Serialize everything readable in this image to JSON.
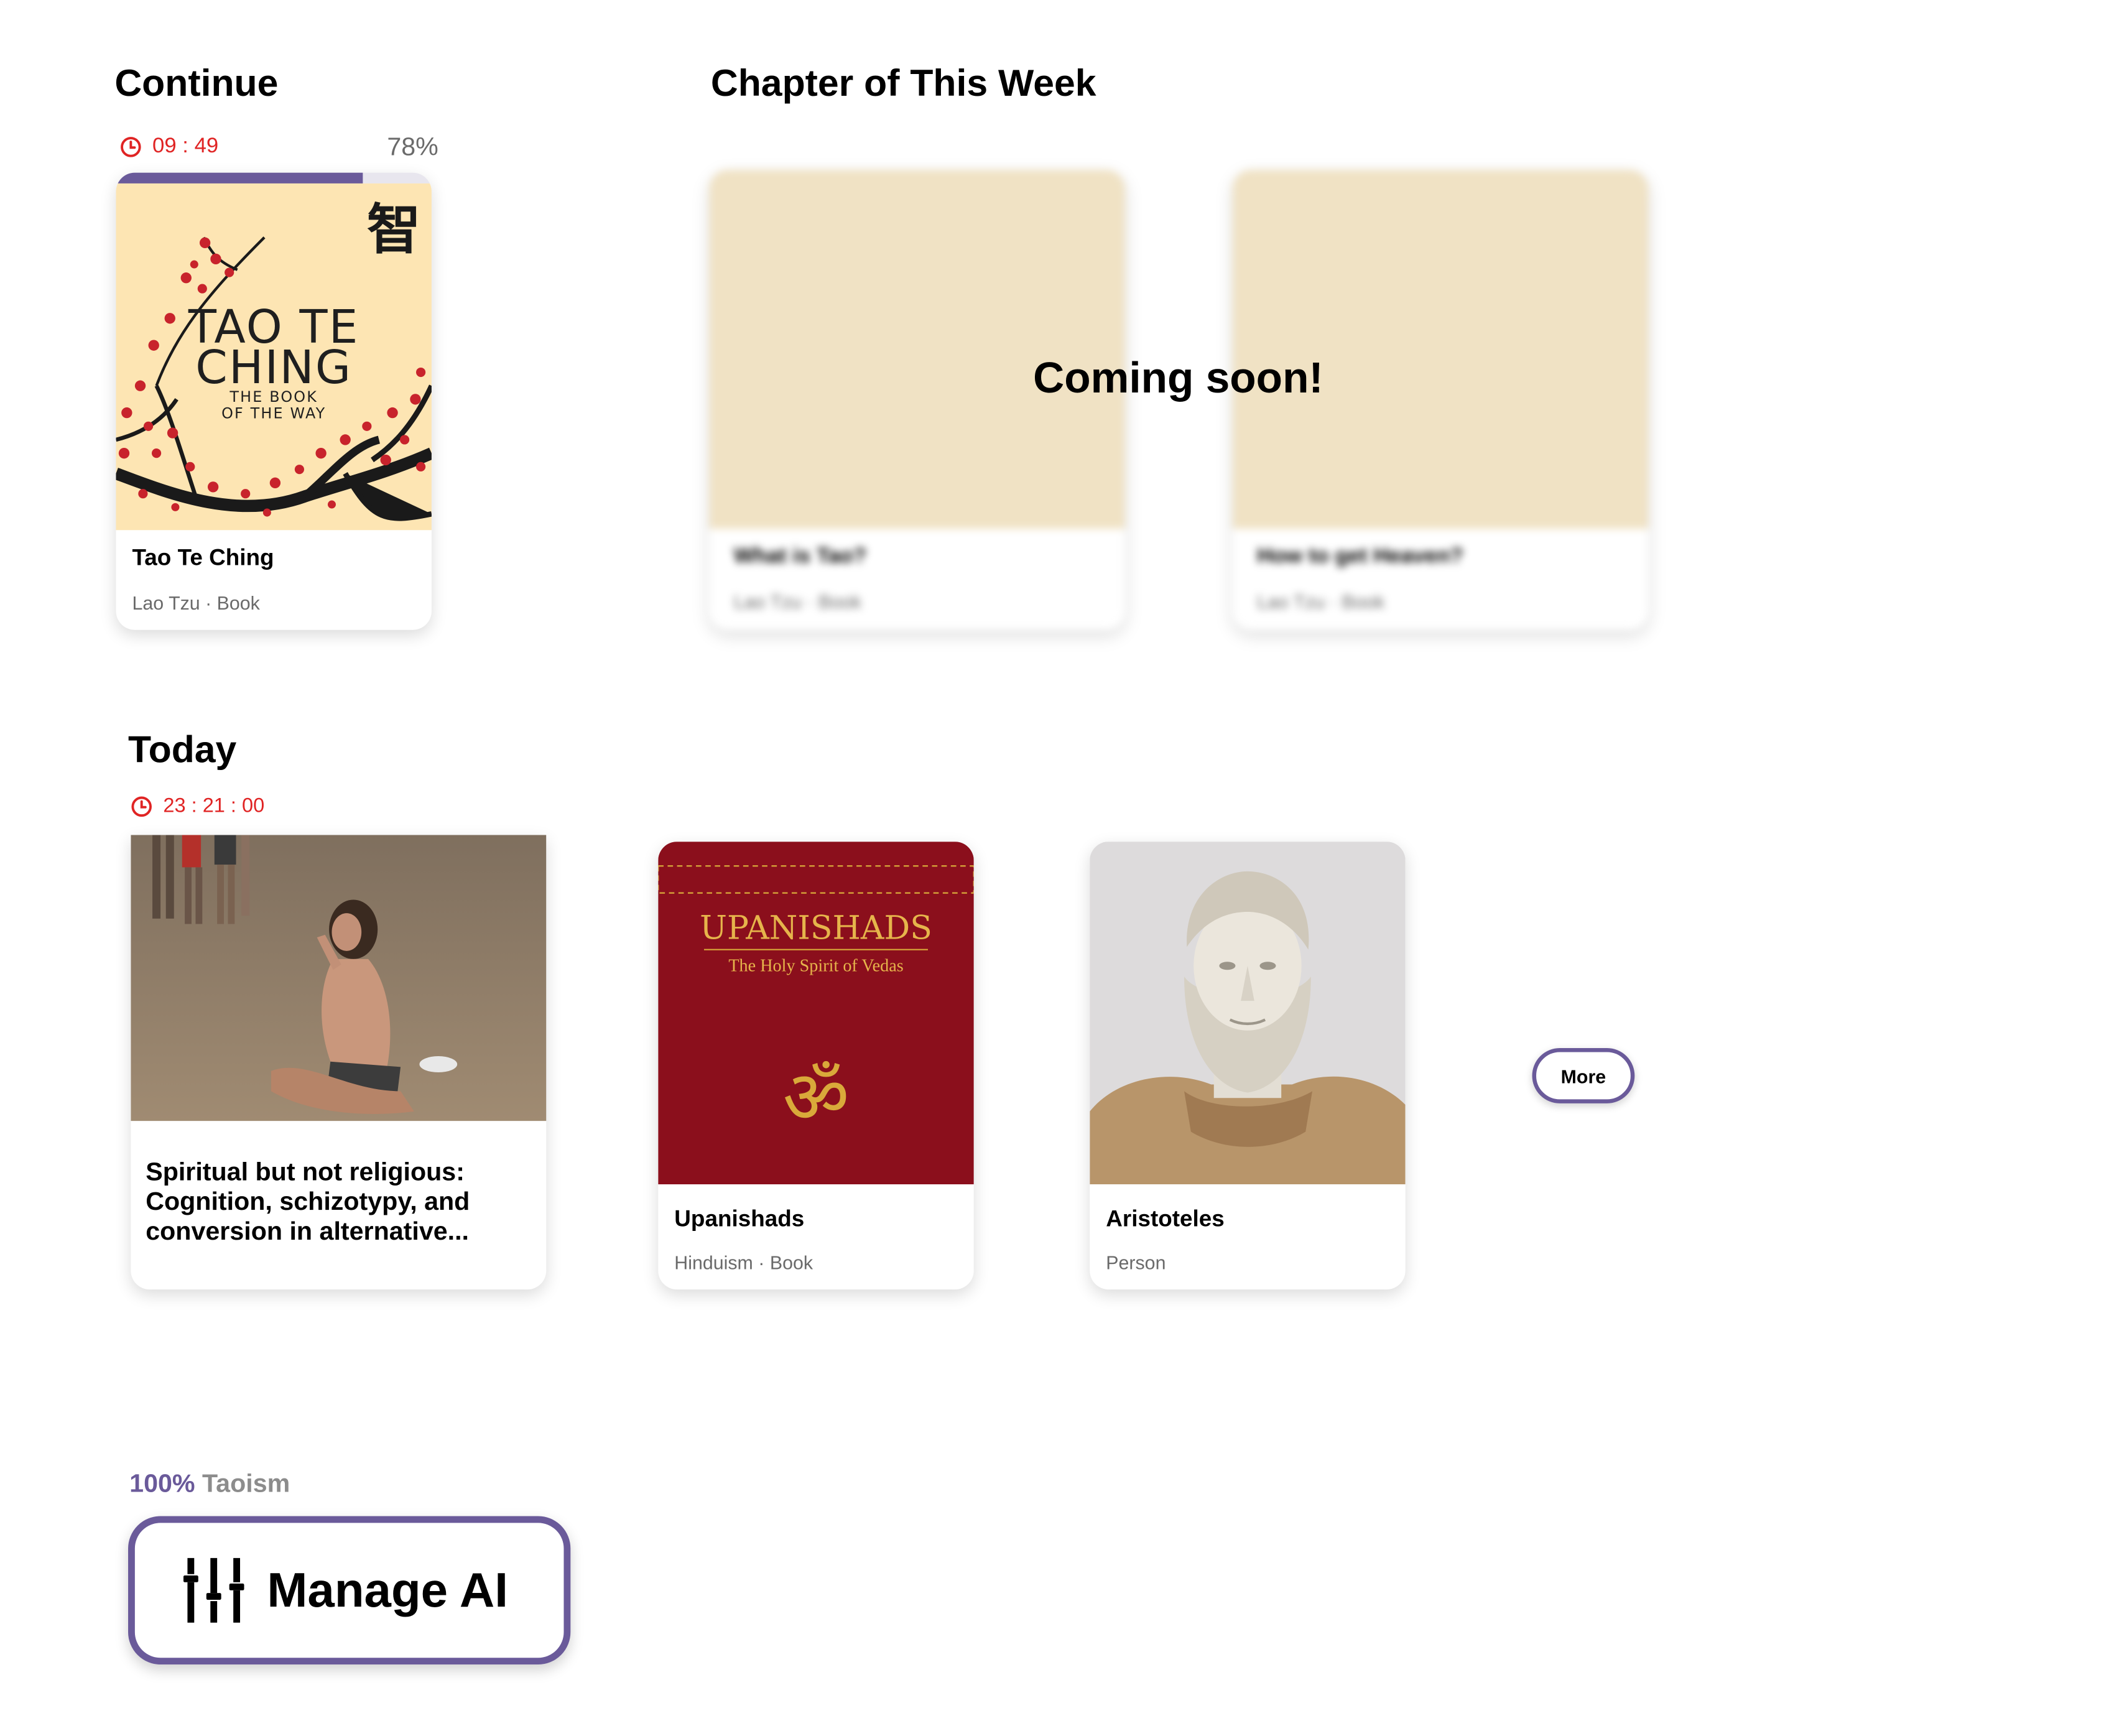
{
  "continue": {
    "heading": "Continue",
    "timer": "09 : 49",
    "progress_percent_label": "78%",
    "progress_fraction": 0.78,
    "book": {
      "title": "Tao Te Ching",
      "subtitle": "Lao Tzu · Book",
      "cover": {
        "title_line1": "TAO TE",
        "title_line2": "CHING",
        "subtitle_line1": "THE BOOK",
        "subtitle_line2": "OF THE WAY",
        "glyph": "智"
      }
    }
  },
  "chapter_week": {
    "heading": "Chapter of This Week",
    "overlay": "Coming soon!",
    "cards": [
      {
        "title": "What is Tao?",
        "subtitle": "Lao Tzu · Book"
      },
      {
        "title": "How to get Heaven?",
        "subtitle": "Lao Tzu · Book"
      }
    ]
  },
  "today": {
    "heading": "Today",
    "timer": "23 : 21 : 00",
    "cards": [
      {
        "title": "Spiritual but not religious: Cognition, schizotypy, and conversion in alternative..."
      },
      {
        "title": "Upanishads",
        "subtitle": "Hinduism · Book",
        "cover": {
          "title": "UPANISHADS",
          "subtitle": "The Holy Spirit of Vedas",
          "symbol": "ॐ"
        }
      },
      {
        "title": "Aristoteles",
        "subtitle": "Person"
      }
    ],
    "more_label": "More"
  },
  "footer": {
    "percent": "100%",
    "topic": "Taoism",
    "manage_label": "Manage AI"
  },
  "colors": {
    "accent": "#6a5a9a",
    "timer_red": "#e02424",
    "placeholder_beige": "#f0e2c4",
    "upanishads_red": "#8b0f1c",
    "gold": "#d9a93a"
  }
}
